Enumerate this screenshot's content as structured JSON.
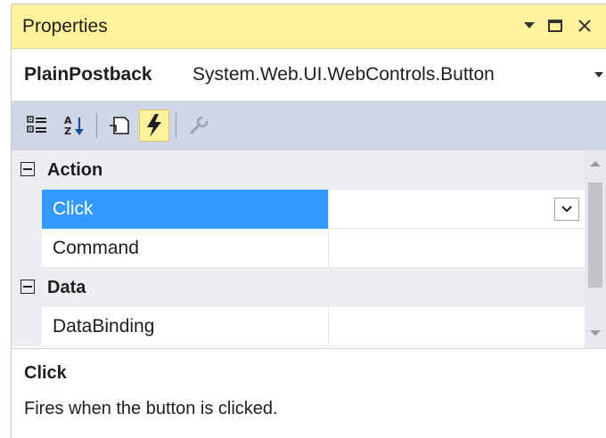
{
  "window": {
    "title": "Properties"
  },
  "object_selector": {
    "name": "PlainPostback",
    "type": "System.Web.UI.WebControls.Button"
  },
  "toolbar": {
    "buttons": [
      {
        "icon": "categorized-icon",
        "active": false
      },
      {
        "icon": "alphabetical-icon",
        "active": false
      },
      {
        "icon": "properties-icon",
        "active": false
      },
      {
        "icon": "events-lightning-icon",
        "active": true
      },
      {
        "icon": "property-pages-wrench-icon",
        "active": false
      }
    ]
  },
  "grid": {
    "categories": [
      {
        "label": "Action",
        "rows": [
          {
            "name": "Click",
            "value": "",
            "selected": true
          },
          {
            "name": "Command",
            "value": ""
          }
        ]
      },
      {
        "label": "Data",
        "rows": [
          {
            "name": "DataBinding",
            "value": ""
          }
        ]
      }
    ]
  },
  "description": {
    "title": "Click",
    "text": "Fires when the button is clicked."
  },
  "colors": {
    "titlebar": "#fff29d",
    "toolbar": "#cfd6e5",
    "selection": "#3399ff",
    "active_button": "#fff29d"
  }
}
